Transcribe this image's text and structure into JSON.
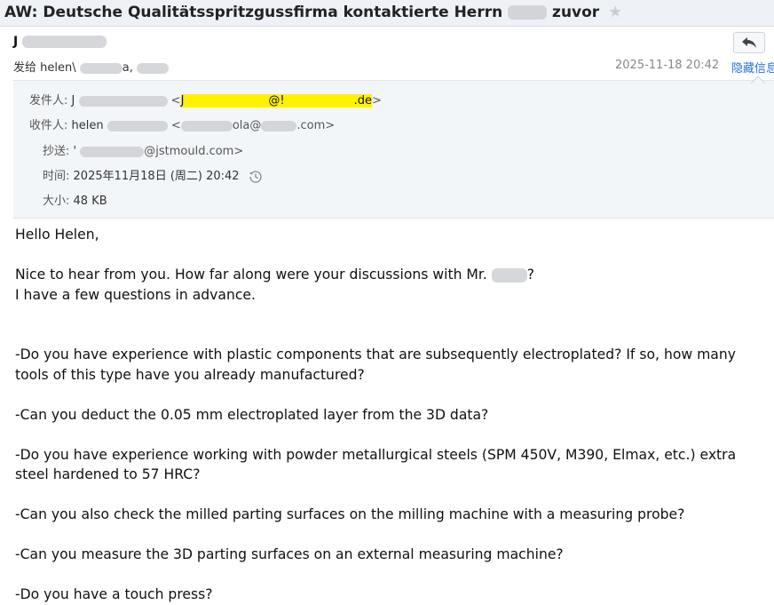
{
  "subject": {
    "prefix": "AW: Deutsche Qualitätsspritzgussfirma kontaktierte Herrn",
    "suffix": "zuvor"
  },
  "sender": {
    "display_name": "J"
  },
  "sent_to": {
    "label": "发给",
    "value": "helen\\",
    "tail": "a,"
  },
  "date": "2025-11-18 20:42",
  "hide_link": "隐藏信息",
  "header": {
    "from_label": "发件人:",
    "from_name": "J",
    "from_email_visible_start": "J",
    "from_email_at": "@!",
    "from_email_domain": ".de",
    "to_label": "收件人:",
    "to_name": "helen",
    "to_email_visible": "ola@",
    "to_email_domain": ".com",
    "cc_label": "抄送:",
    "cc_name": "'",
    "cc_email_domain": "@jstmould.com",
    "time_label": "时间:",
    "time_value": "2025年11月18日 (周二) 20:42",
    "size_label": "大小:",
    "size_value": "48 KB"
  },
  "body": {
    "greeting": "Hello Helen,",
    "line1_start": "Nice to hear from you. How far along were your discussions with Mr.",
    "line1_end": "?",
    "line2": "I have a few questions in advance.",
    "questions": [
      "-Do you have experience with plastic components that are subsequently electroplated? If so, how many tools of this type have you already manufactured?",
      "-Can you deduct the 0.05 mm electroplated layer from the 3D data?",
      "-Do you have experience working with powder metallurgical steels (SPM 450V, M390, Elmax, etc.) extra steel hardened to 57 HRC?",
      "-Can you also check the milled parting surfaces on the milling machine with a measuring probe?",
      "-Can you measure the 3D parting surfaces on an external measuring machine?",
      "-Do you have a touch press?"
    ]
  }
}
